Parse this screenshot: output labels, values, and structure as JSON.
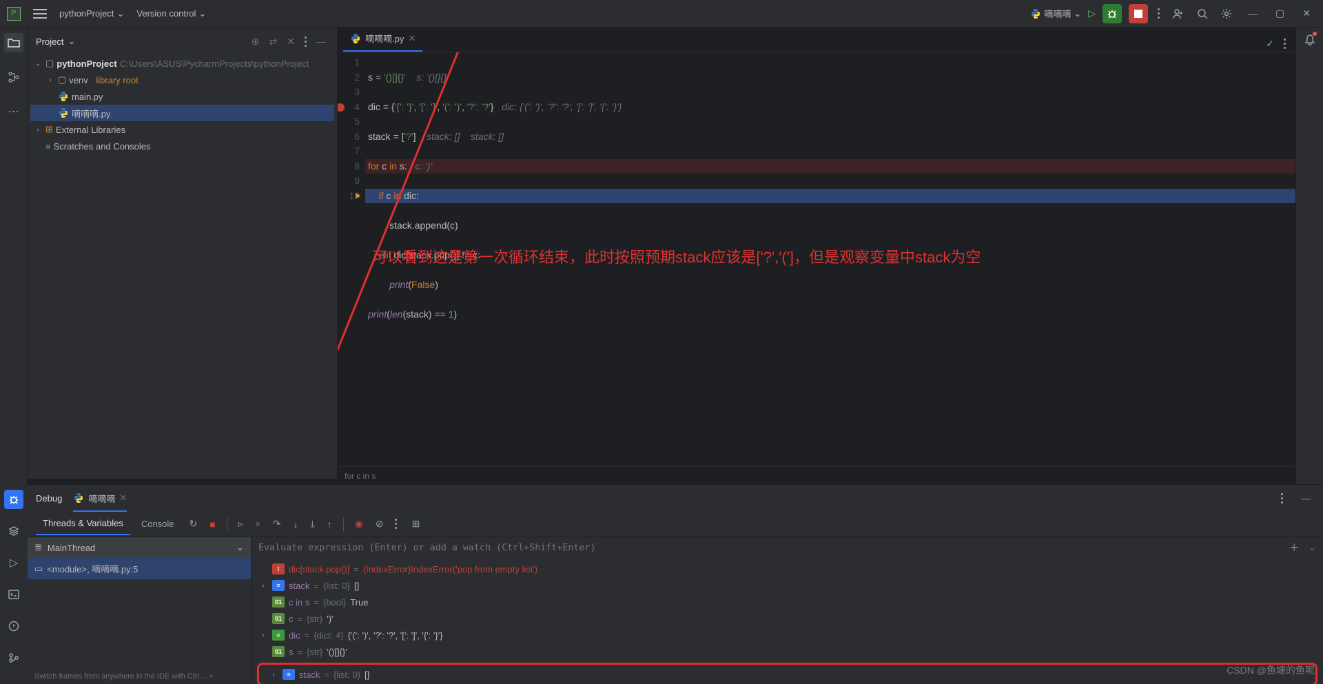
{
  "titlebar": {
    "project_name": "pythonProject",
    "vcs": "Version control",
    "run_config": "嘀嘀嘀"
  },
  "project": {
    "title": "Project",
    "nodes": {
      "root": "pythonProject",
      "root_path": "C:\\Users\\ASUS\\PycharmProjects\\pythonProject",
      "venv": "venv",
      "venv_hint": "library root",
      "file1": "main.py",
      "file2": "嘀嘀嘀.py",
      "ext": "External Libraries",
      "scratch": "Scratches and Consoles"
    }
  },
  "editor": {
    "tab": "嘀嘀嘀.py",
    "breadcrumb": "for c in s",
    "lines": [
      "1",
      "2",
      "3",
      "4",
      "5",
      "6",
      "7",
      "8",
      "9",
      "10"
    ],
    "code": {
      "l1": {
        "a": "s = ",
        "b": "'()[]{}'",
        "c": "    s: '()[]{}'"
      },
      "l2": {
        "a": "dic = {",
        "b": "'{': '}'",
        "c": ", ",
        "d": "'[': ']'",
        "e": ", ",
        "f": "'(': ')'",
        "g": ", ",
        "h": "'?': '?'",
        "i": "}   ",
        "j": "dic: {'(': ')', '?': '?', '[': ']', '{': '}'}"
      },
      "l3": {
        "a": "stack = [",
        "b": "'?'",
        "c": "]    ",
        "d": "stack: []    stack: []"
      },
      "l4": {
        "a": "for ",
        "b": "c ",
        "c": "in ",
        "d": "s:   ",
        "e": "c: ')'"
      },
      "l5": {
        "a": "    if ",
        "b": "c ",
        "c": "in ",
        "d": "dic:"
      },
      "l6": {
        "a": "        stack.append(c)"
      },
      "l7": {
        "a": "    elif ",
        "b": "dic[stack.pop()] != c:"
      },
      "l8": {
        "a": "        ",
        "b": "print",
        "c": "(",
        "d": "False",
        "e": ")"
      },
      "l9": {
        "a": "print",
        "b": "(",
        "c": "len",
        "d": "(stack) == ",
        "e": "1",
        "f": ")"
      }
    },
    "annotation": "可以看到这是第一次循环结束，此时按照预期stack应该是['?','(']，但是观察变量中stack为空"
  },
  "debug": {
    "title": "Debug",
    "tab_name": "嘀嘀嘀",
    "tabs": {
      "threads": "Threads & Variables",
      "console": "Console"
    },
    "thread": "MainThread",
    "frame": "<module>, 嘀嘀嘀.py:5",
    "eval_placeholder": "Evaluate expression (Enter) or add a watch (Ctrl+Shift+Enter)",
    "vars": {
      "v1n": "dic[stack.pop()]",
      "v1e": " = ",
      "v1v": "{IndexError}IndexError('pop from empty list')",
      "v2n": "stack",
      "v2e": " = ",
      "v2t": "{list: 0}",
      "v2v": " []",
      "v3n": "c in s",
      "v3e": " = ",
      "v3t": "{bool}",
      "v3v": " True",
      "v4n": "c",
      "v4e": " = ",
      "v4t": "{str}",
      "v4v": " ')'",
      "v5n": "dic",
      "v5e": " = ",
      "v5t": "{dict: 4}",
      "v5v": " {'(': ')', '?': '?', '[': ']', '{': '}'}",
      "v6n": "s",
      "v6e": " = ",
      "v6t": "{str}",
      "v6v": " '()[]{}'",
      "v7n": "stack",
      "v7e": " = ",
      "v7t": "{list: 0}",
      "v7v": " []"
    }
  },
  "status": "Switch frames from anywhere in the IDE with Ctrl… ×",
  "watermark": "CSDN @鱼塘的鱼呢"
}
